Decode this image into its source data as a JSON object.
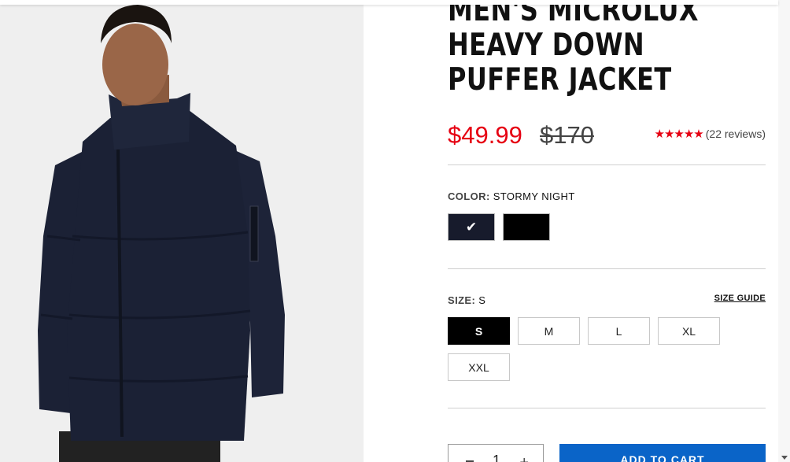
{
  "product": {
    "title": "MEN'S MICROLUX HEAVY DOWN PUFFER JACKET",
    "sale_price": "$49.99",
    "original_price": "$170",
    "rating_stars": "★★★★★",
    "rating_value": 5,
    "reviews": "(22 reviews)"
  },
  "color": {
    "label": "COLOR:",
    "selected": "STORMY NIGHT",
    "swatches": [
      {
        "name": "Stormy Night",
        "hex": "#171b2c",
        "selected": true
      },
      {
        "name": "Black",
        "hex": "#000000",
        "selected": false
      }
    ],
    "check_glyph": "✔"
  },
  "size": {
    "label": "SIZE:",
    "selected": "S",
    "guide": "SIZE GUIDE",
    "options": [
      "S",
      "M",
      "L",
      "XL",
      "XXL"
    ]
  },
  "cart": {
    "quantity": "1",
    "minus_icon": "minus-icon",
    "plus_icon": "plus-icon",
    "add_label": "ADD TO CART"
  },
  "colors": {
    "sale": "#e60012",
    "accent": "#0a64c8",
    "jacket": "#1b2135"
  }
}
